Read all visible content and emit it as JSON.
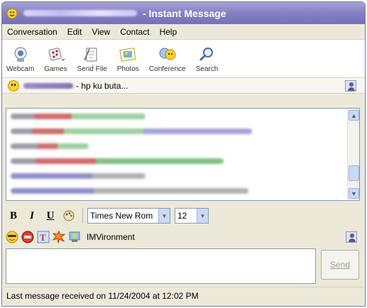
{
  "window": {
    "title_suffix": "- Instant Message"
  },
  "menu": [
    "Conversation",
    "Edit",
    "View",
    "Contact",
    "Help"
  ],
  "toolbar": {
    "buttons": [
      {
        "label": "Webcam",
        "icon": "webcam-icon"
      },
      {
        "label": "Games",
        "icon": "games-icon"
      },
      {
        "label": "Send File",
        "icon": "send-file-icon"
      },
      {
        "label": "Photos",
        "icon": "photos-icon"
      },
      {
        "label": "Conference",
        "icon": "conference-icon"
      },
      {
        "label": "Search",
        "icon": "search-icon"
      }
    ]
  },
  "status": {
    "message": "- hp ku buta..."
  },
  "format": {
    "bold": "B",
    "italic": "I",
    "underline": "U",
    "font_name": "Times New Rom",
    "font_size": "12"
  },
  "imvironment": {
    "label": "IMVironment"
  },
  "send": {
    "label": "Send"
  },
  "statusbar": {
    "text": "Last message received on 11/24/2004 at 12:02 PM"
  },
  "colors": {
    "title_gradient": "#8581c4",
    "accent_blue": "#c9d9f7"
  }
}
